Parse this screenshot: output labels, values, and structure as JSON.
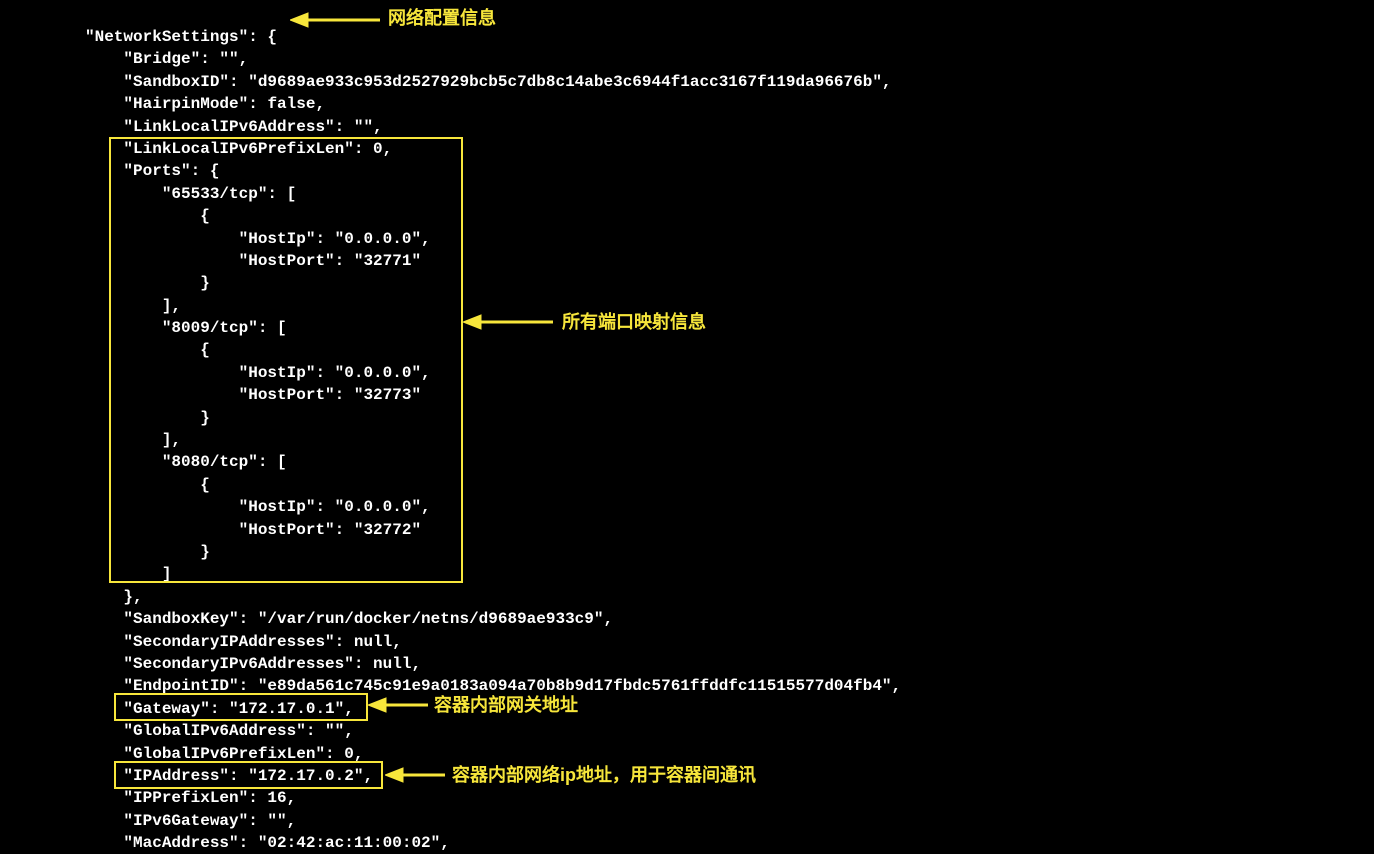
{
  "json_lines": [
    "\"NetworkSettings\": {",
    "    \"Bridge\": \"\",",
    "    \"SandboxID\": \"d9689ae933c953d2527929bcb5c7db8c14abe3c6944f1acc3167f119da96676b\",",
    "    \"HairpinMode\": false,",
    "    \"LinkLocalIPv6Address\": \"\",",
    "    \"LinkLocalIPv6PrefixLen\": 0,",
    "    \"Ports\": {",
    "        \"65533/tcp\": [",
    "            {",
    "                \"HostIp\": \"0.0.0.0\",",
    "                \"HostPort\": \"32771\"",
    "            }",
    "        ],",
    "        \"8009/tcp\": [",
    "            {",
    "                \"HostIp\": \"0.0.0.0\",",
    "                \"HostPort\": \"32773\"",
    "            }",
    "        ],",
    "        \"8080/tcp\": [",
    "            {",
    "                \"HostIp\": \"0.0.0.0\",",
    "                \"HostPort\": \"32772\"",
    "            }",
    "        ]",
    "    },",
    "    \"SandboxKey\": \"/var/run/docker/netns/d9689ae933c9\",",
    "    \"SecondaryIPAddresses\": null,",
    "    \"SecondaryIPv6Addresses\": null,",
    "    \"EndpointID\": \"e89da561c745c91e9a0183a094a70b8b9d17fbdc5761ffddfc11515577d04fb4\",",
    "    \"Gateway\": \"172.17.0.1\",",
    "    \"GlobalIPv6Address\": \"\",",
    "    \"GlobalIPv6PrefixLen\": 0,",
    "    \"IPAddress\": \"172.17.0.2\",",
    "    \"IPPrefixLen\": 16,",
    "    \"IPv6Gateway\": \"\",",
    "    \"MacAddress\": \"02:42:ac:11:00:02\","
  ],
  "annotations": {
    "network_settings": "网络配置信息",
    "ports": "所有端口映射信息",
    "gateway": "容器内部网关地址",
    "ipaddress": "容器内部网络ip地址，用于容器间通讯"
  }
}
